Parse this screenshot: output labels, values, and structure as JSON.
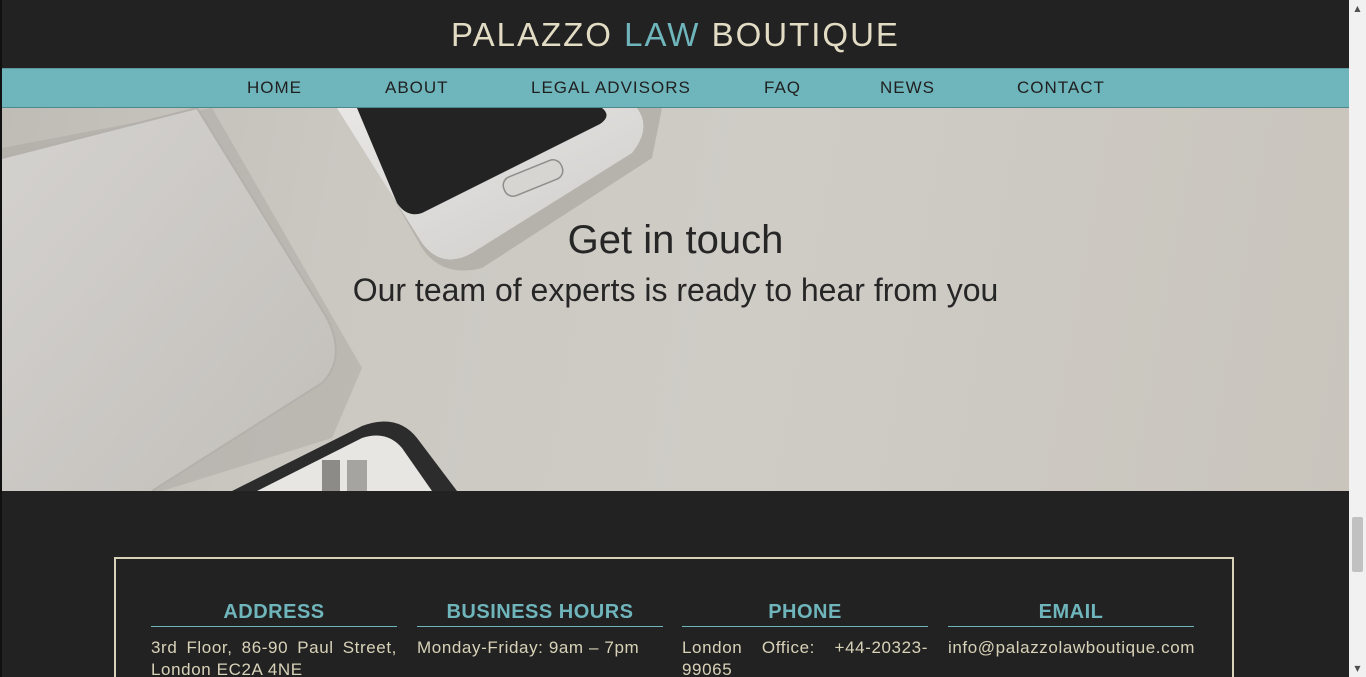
{
  "header": {
    "logo_part1": "PALAZZO ",
    "logo_part2": "LAW",
    "logo_part3": " BOUTIQUE"
  },
  "nav": {
    "items": [
      {
        "label": "HOME"
      },
      {
        "label": "ABOUT"
      },
      {
        "label": "LEGAL ADVISORS"
      },
      {
        "label": "FAQ"
      },
      {
        "label": "NEWS"
      },
      {
        "label": "CONTACT"
      }
    ]
  },
  "hero": {
    "title": "Get in touch",
    "subtitle": "Our team of experts is ready to hear from you"
  },
  "contact": {
    "address": {
      "heading": "ADDRESS",
      "text": "3rd Floor, 86-90 Paul Street, London EC2A 4NE"
    },
    "hours": {
      "heading": "BUSINESS HOURS",
      "text": "Monday-Friday: 9am – 7pm"
    },
    "phone": {
      "heading": "PHONE",
      "text": "London Office: +44-20323-99065"
    },
    "email": {
      "heading": "EMAIL",
      "text": "info@palazzolawboutique.com"
    }
  },
  "colors": {
    "accent": "#6fb5bc",
    "background": "#222222",
    "logo_text": "#e3dcc4",
    "body_text": "#d8d2b8"
  },
  "icons": {
    "scroll_up": "scroll-up-arrow-icon",
    "scroll_down": "scroll-down-arrow-icon"
  }
}
